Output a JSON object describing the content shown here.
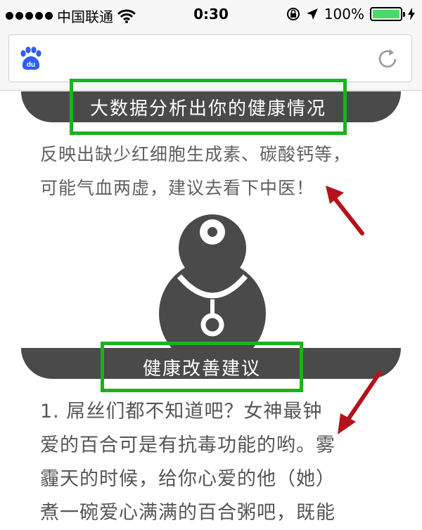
{
  "status_bar": {
    "carrier": "中国联通",
    "time": "0:30",
    "battery_percent_label": "100%",
    "battery_level": 1.0
  },
  "browser": {
    "logo_icon": "baidu-paw-icon",
    "reload_icon": "reload-icon"
  },
  "section1": {
    "title": "大数据分析出你的健康情况",
    "text_line1": "反映出缺少红细胞生成素、碳酸钙等，",
    "text_line2": "可能气血两虚，建议去看下中医！"
  },
  "section2": {
    "title": "健康改善建议",
    "line1": "1. 屌丝们都不知道吧？女神最钟",
    "line2": "爱的百合可是有抗毒功能的哟。雾",
    "line3": "霾天的时候，给你心爱的他（她）",
    "line4": "煮一碗爱心满满的百合粥吧，既能"
  },
  "colors": {
    "highlight_green": "#19b31d",
    "arrow_red": "#b5121b",
    "banner_dark": "#4a4a4a",
    "battery_green": "#4cd964"
  }
}
